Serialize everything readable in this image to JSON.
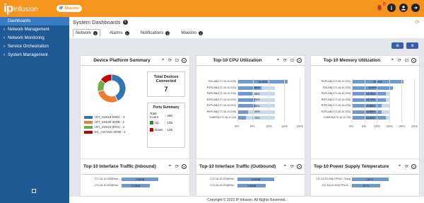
{
  "header": {
    "logo_ip": "ip",
    "logo_text": "infusion",
    "product_badge": "IP",
    "product_name": "Maestro",
    "notification_count": "1",
    "info_icon": "info-icon",
    "user_icon": "user-icon",
    "logout_icon": "logout-icon"
  },
  "sidebar": {
    "items": [
      {
        "label": "Dashboards",
        "active": true,
        "chevron": ""
      },
      {
        "label": "Network Management",
        "chevron": "›"
      },
      {
        "label": "Network Monitoring",
        "chevron": "›"
      },
      {
        "label": "Service Orchestration",
        "chevron": "›"
      },
      {
        "label": "System Management",
        "chevron": "›"
      }
    ]
  },
  "page": {
    "title": "System Dashboards",
    "tabs": [
      {
        "label": "Network",
        "active": true
      },
      {
        "label": "Alarms"
      },
      {
        "label": "Notifications"
      },
      {
        "label": "Maestro"
      }
    ],
    "btn_add": "⊞",
    "btn_settings": "⚙"
  },
  "device_platform": {
    "title": "Device Platform Summary",
    "legend": [
      {
        "label": "UFI_SS010-28DC : 3",
        "color": "#2e75b6"
      },
      {
        "label": "UFI_SS030-30XB : 2",
        "color": "#ed7d31"
      },
      {
        "label": "UFI_SS010-30XC : 1",
        "color": "#70ad47"
      },
      {
        "label": "EC_AS7315-30XB : 1",
        "color": "#c00000"
      }
    ],
    "total_devices_label": "Total Devices Connected",
    "total_devices_value": "7",
    "ports_summary_title": "Ports Summary",
    "ports": [
      {
        "label": "Total Count",
        "value": ": 260",
        "color": ""
      },
      {
        "label": "Up",
        "value": ": 105",
        "color": "#2e8b2e"
      },
      {
        "label": "Down",
        "value": ": 145",
        "color": "#c00000"
      }
    ]
  },
  "chart_data": [
    {
      "type": "bar",
      "title": "Top-10 CPU Utilization",
      "categories": [
        "R0LAB(172.16.10.209)",
        "R1PLAB(172.16.10.201)",
        "R4PLAB(172.16.10.204)",
        "R3PLAB(172.16.10.203)",
        "R2PLAB(172.16.10.202)",
        "R5PLAB(172.16.10.205)",
        "OnMDS(172.16.10.24)"
      ],
      "value_labels": [
        "16.15%",
        "7.80%",
        "4.68%",
        "5.78%",
        "5.68%",
        "3.40%",
        "2.78%"
      ],
      "values": [
        16.15,
        7.8,
        4.68,
        5.78,
        5.68,
        3.4,
        2.78
      ],
      "xticks": [
        "0%",
        "5%",
        "10%",
        "15%",
        "20%"
      ],
      "xlim": [
        0,
        20
      ]
    },
    {
      "type": "bar",
      "title": "Top-10 Memory Utilization",
      "categories": [
        "R1PLAB(172.16.10.201)",
        "R0LAB(172.16.10.209)",
        "R4PLAB(172.16.10.204)",
        "R5PLAB(172.16.10.205)",
        "R3PLAB(172.16.10.203)",
        "R2PLAB(172.16.10.202)",
        "OnMDS(172.16.10.24)"
      ],
      "value_labels": [
        "20.60%",
        "16.60%",
        "13.70%",
        "13.72%",
        "11.85%",
        "11.85%",
        "13.69%"
      ],
      "values": [
        20.6,
        16.6,
        13.7,
        13.72,
        11.85,
        11.85,
        13.69
      ],
      "xticks": [
        "0%",
        "5%",
        "10%",
        "15%",
        "20%",
        "25%"
      ],
      "xlim": [
        0,
        25
      ]
    }
  ],
  "bottom_cards": [
    {
      "title": "Top-10 Interface Traffic (Inbound)",
      "row_labels": [
        "172.16.10.208(Ethe...",
        "172.16.10.203(Ethe..."
      ],
      "row_values": [
        "3.32GB",
        "2.13GB"
      ]
    },
    {
      "title": "Top-10 Interface Traffic (Outbound)",
      "row_labels": [
        "172.16.10.203(Ethe...",
        "172.16.10.200(Ethe..."
      ],
      "row_values": [
        "3.42GB",
        "2.35GB"
      ]
    },
    {
      "title": "Top-10 Power Supply Temperature",
      "row_labels": [
        "172.16.10.205(+PSU2, Temp",
        "172.16.10.201(+PSU1..."
      ],
      "row_values": [
        "29 °C",
        "29 °C"
      ]
    }
  ],
  "footer": {
    "text": "Copyright © 2023 IP Infusion. All Rights Reserved."
  }
}
